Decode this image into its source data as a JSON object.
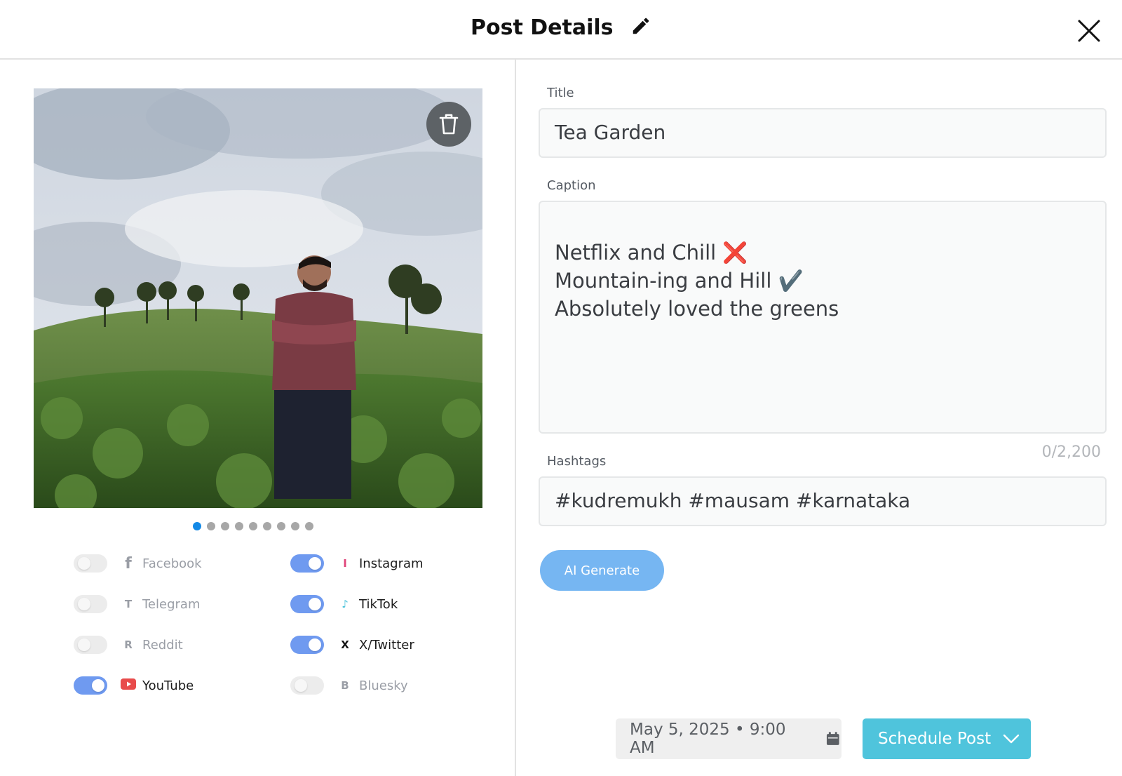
{
  "header": {
    "title": "Post Details"
  },
  "media": {
    "slide_count": 9,
    "active_slide": 1
  },
  "platforms": [
    {
      "label": "Facebook",
      "icon_glyph": "f",
      "icon_name": "facebook-icon",
      "icon_color": "#9a9ea6",
      "enabled": false
    },
    {
      "label": "Telegram",
      "icon_glyph": "T",
      "icon_name": "telegram-icon",
      "icon_color": "#9a9ea6",
      "enabled": false
    },
    {
      "label": "Reddit",
      "icon_glyph": "R",
      "icon_name": "reddit-icon",
      "icon_color": "#9a9ea6",
      "enabled": false
    },
    {
      "label": "YouTube",
      "icon_glyph": "",
      "icon_name": "youtube-icon",
      "icon_color": "#e84b4b",
      "enabled": true
    },
    {
      "label": "Instagram",
      "icon_glyph": "I",
      "icon_name": "instagram-icon",
      "icon_color": "#e0447a",
      "enabled": true
    },
    {
      "label": "TikTok",
      "icon_glyph": "♪",
      "icon_name": "tiktok-icon",
      "icon_color": "#4fc4dc",
      "enabled": true
    },
    {
      "label": "X/Twitter",
      "icon_glyph": "X",
      "icon_name": "x-twitter-icon",
      "icon_color": "#111111",
      "enabled": true
    },
    {
      "label": "Bluesky",
      "icon_glyph": "B",
      "icon_name": "bluesky-icon",
      "icon_color": "#9a9ea6",
      "enabled": false
    }
  ],
  "form": {
    "title_label": "Title",
    "title_value": "Tea Garden",
    "caption_label": "Caption",
    "caption_value": "Netflix and Chill ❌\nMountain-ing and Hill ✔️\nAbsolutely loved the greens",
    "caption_counter": "0/2,200",
    "hashtags_label": "Hashtags",
    "hashtags_value": "#kudremukh #mausam #karnataka",
    "ai_generate_label": "AI Generate"
  },
  "schedule": {
    "datetime": "May 5, 2025 • 9:00 AM",
    "button_label": "Schedule Post"
  },
  "colors": {
    "accent_toggle_on": "#6f9af0",
    "schedule_button": "#4fc4dc",
    "ai_button": "#76b6f2",
    "active_dot": "#1389e6"
  }
}
